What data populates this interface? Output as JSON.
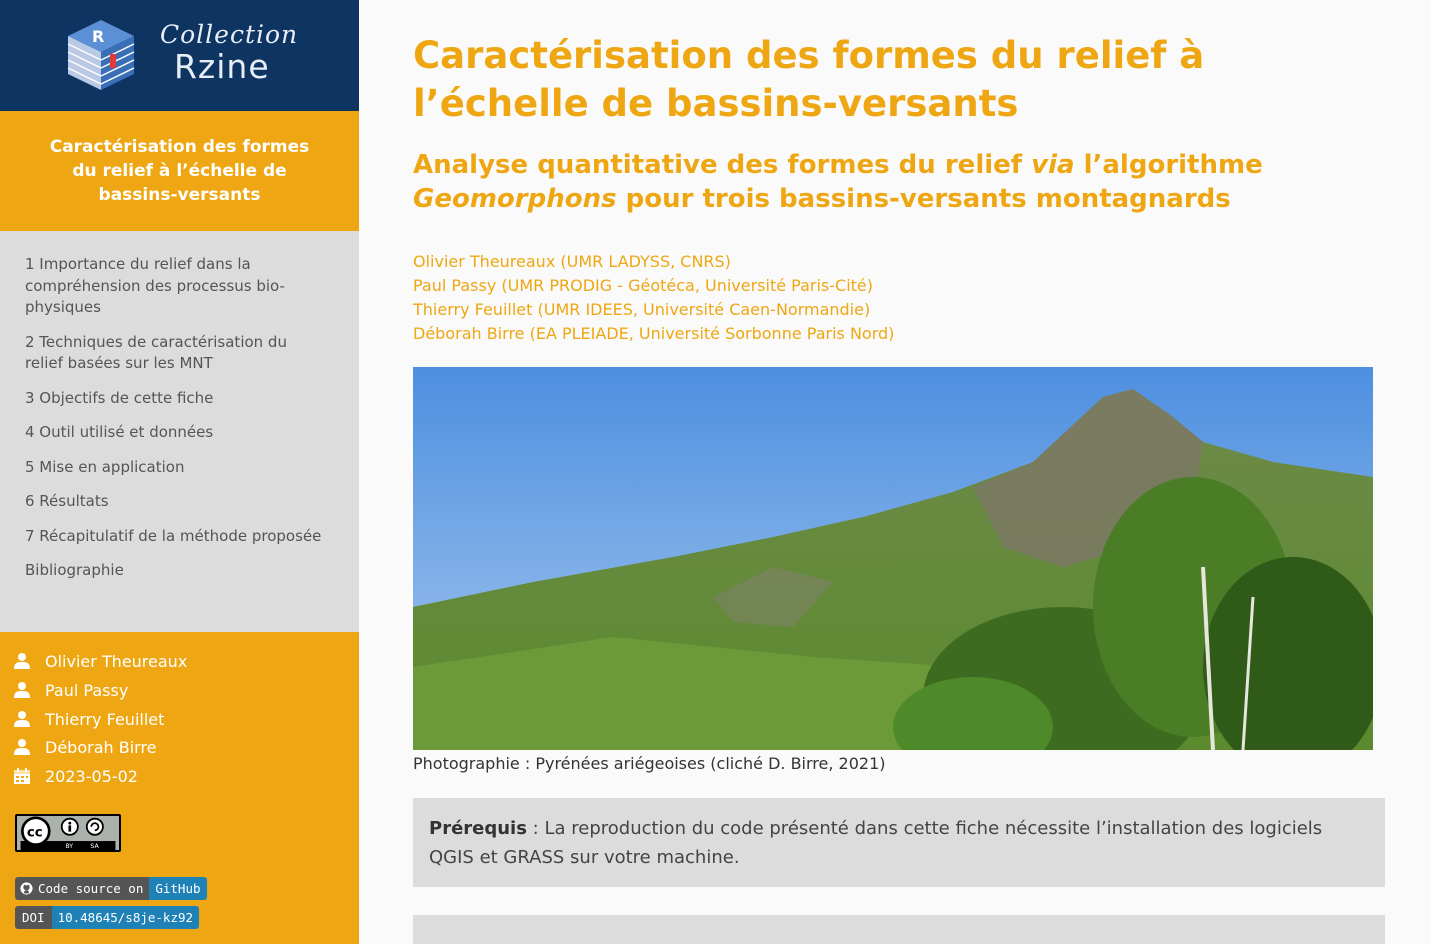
{
  "brand": {
    "collection": "Collection",
    "name": "Rzine"
  },
  "sidebar": {
    "title": "Caractérisation des formes du relief à l’échelle de bassins-versants",
    "toc": [
      "1 Importance du relief dans la compréhension des processus bio-physiques",
      "2 Techniques de caractérisation du relief basées sur les MNT",
      "3 Objectifs de cette fiche",
      "4 Outil utilisé et données",
      "5 Mise en application",
      "6 Résultats",
      "7 Récapitulatif de la méthode proposée",
      "Bibliographie"
    ],
    "authors": [
      "Olivier Theureaux",
      "Paul Passy",
      "Thierry Feuillet",
      "Déborah Birre"
    ],
    "date": "2023-05-02",
    "license": {
      "by": "BY",
      "sa": "SA"
    },
    "github_badge": {
      "left": "Code source on",
      "right": "GitHub"
    },
    "doi_badge": {
      "left": "DOI",
      "right": "10.48645/s8je-kz92"
    }
  },
  "main": {
    "title": "Caractérisation des formes du relief à l’échelle de bassins-versants",
    "subtitle": {
      "part1": "Analyse quantitative des formes du relief ",
      "via": "via",
      "part2": " l’algorithme",
      "geomorphons": "Geomorphons",
      "part3": " pour trois bassins-versants montagnards"
    },
    "authors": [
      "Olivier Theureaux (UMR LADYSS, CNRS)",
      "Paul Passy (UMR PRODIG - Géotéca, Université Paris-Cité)",
      "Thierry Feuillet (UMR IDEES, Université Caen-Normandie)",
      "Déborah Birre (EA PLEIADE, Université Sorbonne Paris Nord)"
    ],
    "caption": "Photographie : Pyrénées ariégeoises (cliché D. Birre, 2021)",
    "prereq_label": "Prérequis",
    "prereq_text": " : La reproduction du code présenté dans cette fiche nécessite l’installation des logiciels QGIS et GRASS sur votre machine."
  },
  "colors": {
    "accent": "#eea712",
    "brand_bg": "#0e3561",
    "sidebar_bg": "#dcdcdc",
    "badge_blue": "#1e82b6"
  }
}
